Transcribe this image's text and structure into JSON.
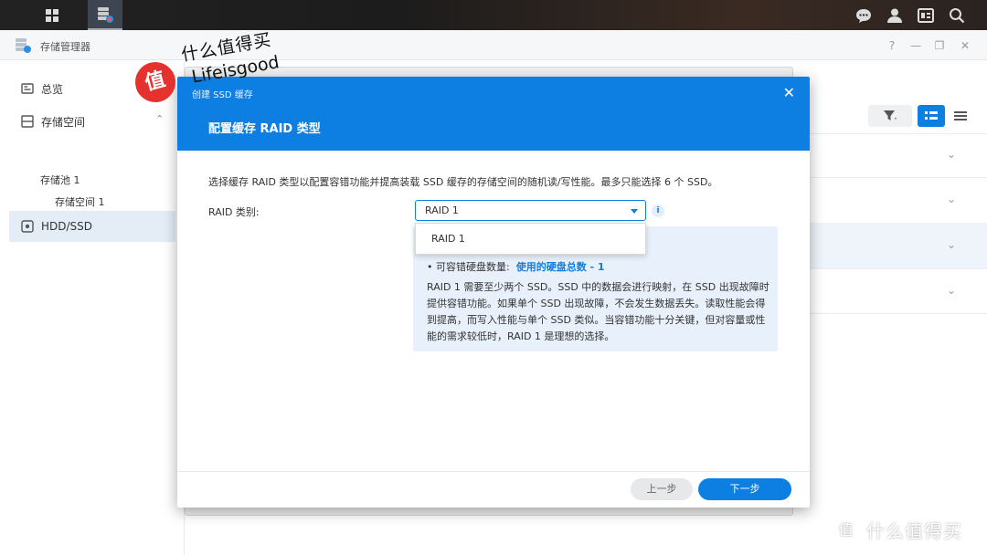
{
  "app": {
    "title": "存储管理器",
    "window_controls": {
      "help": "?",
      "minimize": "—",
      "restore": "❐",
      "close": "✕"
    }
  },
  "sidebar": {
    "items": [
      {
        "label": "总览",
        "icon": "overview-icon"
      },
      {
        "label": "存储空间",
        "icon": "storage-icon",
        "chevron": "⌃"
      },
      {
        "label": "HDD/SSD",
        "icon": "drive-icon"
      }
    ],
    "sub_items": [
      "存储池 1",
      "存储空间 1"
    ]
  },
  "dialog": {
    "window_title": "创建 SSD 缓存",
    "close": "✕",
    "heading": "配置缓存 RAID 类型",
    "description": "选择缓存 RAID 类型以配置容错功能并提高装载 SSD 缓存的存储空间的随机读/写性能。最多只能选择 6 个 SSD。",
    "raid_label": "RAID 类别:",
    "raid_selected": "RAID 1",
    "raid_options": [
      "RAID 1"
    ],
    "info_icon": "i",
    "bullet_label": "• 可容错硬盘数量:",
    "bullet_value": "使用的硬盘总数 - 1",
    "info_text": "RAID 1 需要至少两个 SSD。SSD 中的数据会进行映射，在 SSD 出现故障时提供容错功能。如果单个 SSD 出现故障，不会发生数据丢失。读取性能会得到提高，而写入性能与单个 SSD 类似。当容错功能十分关键，但对容量或性能的需求较低时，RAID 1 是理想的选择。",
    "prev_button": "上一步",
    "next_button": "下一步"
  },
  "watermark": {
    "badge": "值",
    "line1": "什么值得买",
    "line2": "Lifeisgood",
    "corner_badge": "值",
    "corner": "什么值得买"
  },
  "colors": {
    "accent": "#0d7fe3",
    "info_bg": "#e8f1fb",
    "badge_red": "#e6322e"
  }
}
